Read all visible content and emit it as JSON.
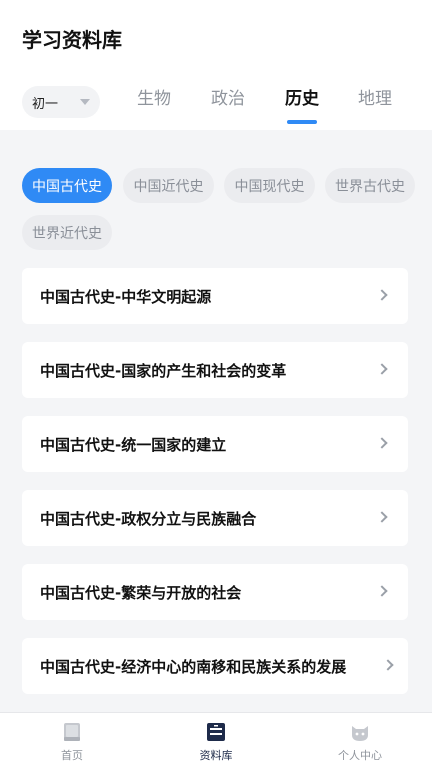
{
  "header": {
    "title": "学习资料库"
  },
  "grade_select": {
    "value": "初一"
  },
  "subject_tabs": [
    {
      "label": "生物",
      "active": false
    },
    {
      "label": "政治",
      "active": false
    },
    {
      "label": "历史",
      "active": true
    },
    {
      "label": "地理",
      "active": false
    }
  ],
  "chips": [
    {
      "label": "中国古代史",
      "active": true
    },
    {
      "label": "中国近代史",
      "active": false
    },
    {
      "label": "中国现代史",
      "active": false
    },
    {
      "label": "世界古代史",
      "active": false
    },
    {
      "label": "世界近代史",
      "active": false
    }
  ],
  "list_items": [
    {
      "label": "中国古代史-中华文明起源"
    },
    {
      "label": "中国古代史-国家的产生和社会的变革"
    },
    {
      "label": "中国古代史-统一国家的建立"
    },
    {
      "label": "中国古代史-政权分立与民族融合"
    },
    {
      "label": "中国古代史-繁荣与开放的社会"
    },
    {
      "label": "中国古代史-经济中心的南移和民族关系的发展"
    }
  ],
  "bottom_nav": [
    {
      "label": "首页",
      "icon": "book-icon",
      "active": false
    },
    {
      "label": "资料库",
      "icon": "library-icon",
      "active": true
    },
    {
      "label": "个人中心",
      "icon": "cat-avatar-icon",
      "active": false
    }
  ],
  "colors": {
    "accent": "#2f8af5",
    "nav_active": "#1e2b4a",
    "inactive_text": "#8f949c",
    "background": "#f4f5f7"
  }
}
